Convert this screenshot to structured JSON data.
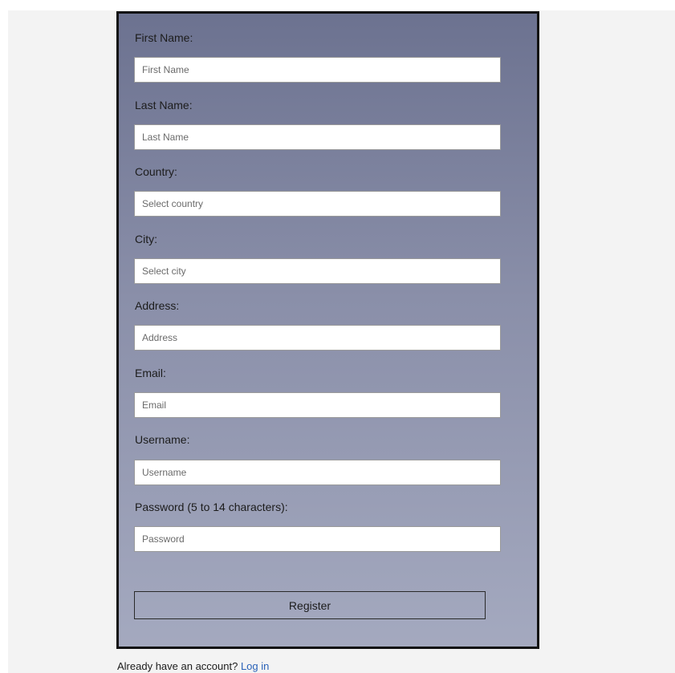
{
  "form": {
    "fields": [
      {
        "label": "First Name:",
        "placeholder": "First Name"
      },
      {
        "label": "Last Name:",
        "placeholder": "Last Name"
      },
      {
        "label": "Country:",
        "placeholder": "Select country"
      },
      {
        "label": "City:",
        "placeholder": "Select city"
      },
      {
        "label": "Address:",
        "placeholder": "Address"
      },
      {
        "label": "Email:",
        "placeholder": "Email"
      },
      {
        "label": "Username:",
        "placeholder": "Username"
      },
      {
        "label": "Password (5 to 14 characters):",
        "placeholder": "Password"
      }
    ],
    "submit_label": "Register"
  },
  "footer": {
    "prompt": "Already have an account?",
    "login_link": "Log in"
  },
  "colors": {
    "gradient_top": "#6c7290",
    "gradient_bottom": "#a4a9bf",
    "link": "#2a62b8",
    "card_border": "#111111"
  }
}
